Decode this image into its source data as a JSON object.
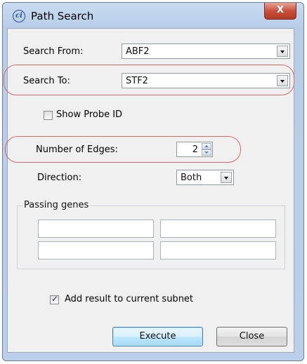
{
  "window": {
    "title": "Path Search",
    "app_icon_text": "ci",
    "close_symbol": "X"
  },
  "search_from": {
    "label": "Search From:",
    "value": "ABF2"
  },
  "search_to": {
    "label": "Search To:",
    "value": "STF2"
  },
  "show_probe_id": {
    "label": "Show Probe ID",
    "checked": false
  },
  "number_of_edges": {
    "label": "Number of Edges:",
    "value": "2"
  },
  "direction": {
    "label": "Direction:",
    "value": "Both"
  },
  "passing_genes": {
    "legend": "Passing genes",
    "fields": [
      "",
      "",
      "",
      ""
    ]
  },
  "add_result": {
    "label": "Add result to current subnet",
    "checked": true,
    "check_symbol": "✓"
  },
  "buttons": {
    "execute": "Execute",
    "close": "Close"
  },
  "highlight_color": "#d9696a"
}
